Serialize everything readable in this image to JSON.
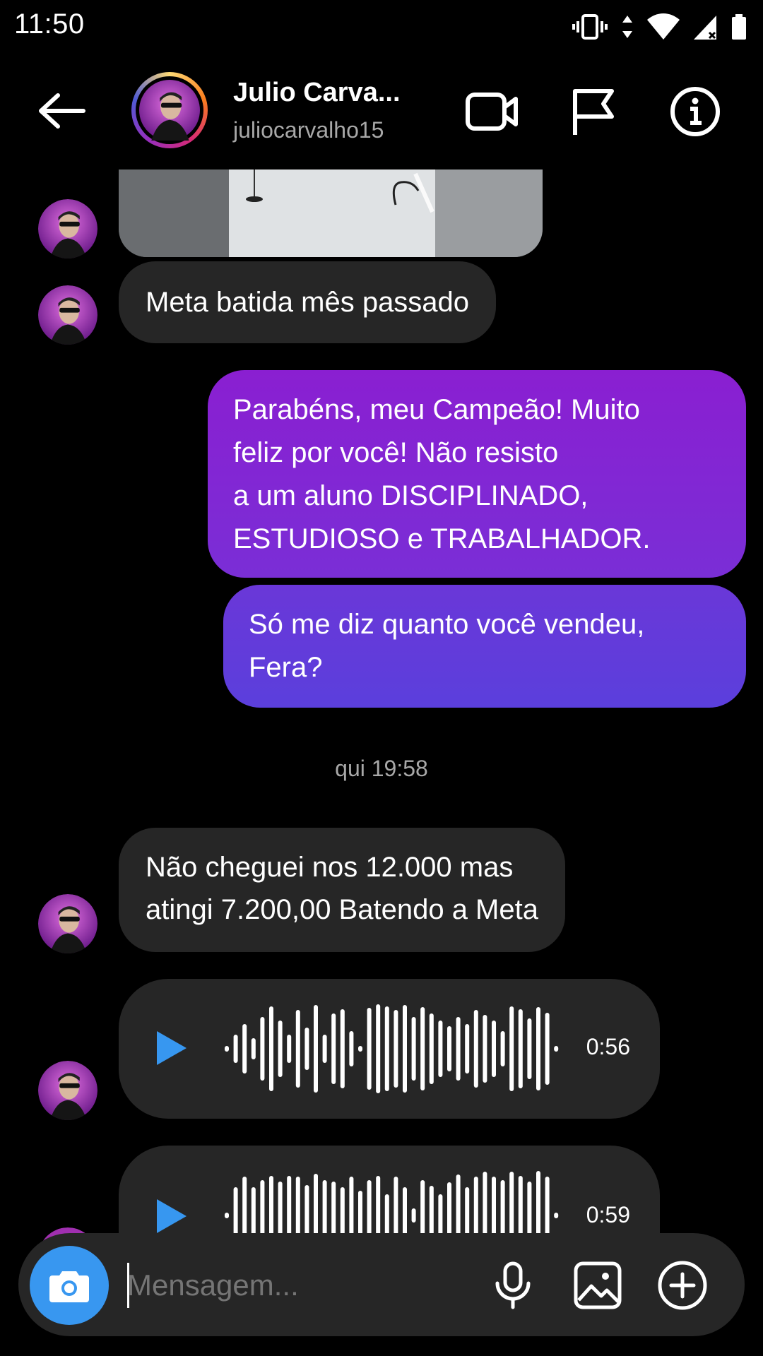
{
  "status_bar": {
    "time": "11:50"
  },
  "header": {
    "name": "Julio Carva...",
    "username": "juliocarvalho15",
    "icons": [
      "back-arrow-icon",
      "video-call-icon",
      "flag-icon",
      "info-icon"
    ]
  },
  "messages": [
    {
      "type": "image",
      "sender": "contact"
    },
    {
      "type": "text",
      "sender": "contact",
      "text": "Meta batida mês passado"
    },
    {
      "type": "text",
      "sender": "me",
      "lines": [
        "Parabéns, meu Campeão! Muito",
        "feliz por você! Não resisto",
        "a um aluno DISCIPLINADO,",
        "ESTUDIOSO e TRABALHADOR."
      ]
    },
    {
      "type": "text",
      "sender": "me",
      "lines": [
        "Só me diz quanto você vendeu,",
        "Fera?"
      ]
    },
    {
      "type": "timestamp",
      "text": "qui 19:58"
    },
    {
      "type": "text",
      "sender": "contact",
      "lines": [
        "Não cheguei nos 12.000 mas",
        "atingi 7.200,00 Batendo a Meta"
      ]
    },
    {
      "type": "audio",
      "sender": "contact",
      "duration": "0:56"
    },
    {
      "type": "audio",
      "sender": "contact",
      "duration": "0:59"
    }
  ],
  "composer": {
    "placeholder": "Mensagem...",
    "icons": [
      "camera-icon",
      "microphone-icon",
      "gallery-icon",
      "add-icon"
    ]
  },
  "colors": {
    "background": "#000000",
    "incoming_bubble": "#262626",
    "outgoing_gradient_top": "#8a1fd1",
    "outgoing_gradient_bottom": "#5b3fdc",
    "play_button": "#3797f0",
    "camera_button": "#3897f0"
  }
}
